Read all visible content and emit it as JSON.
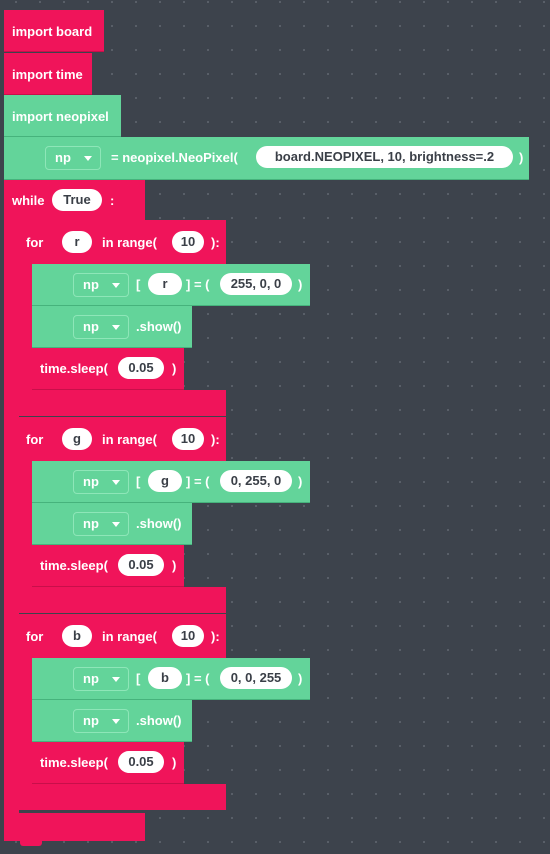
{
  "colors": {
    "background": "#3d434c",
    "control_block": "#f0145a",
    "value_block": "#63d49a"
  },
  "imports": [
    {
      "label": "import board"
    },
    {
      "label": "import time"
    },
    {
      "label": "import neopixel"
    }
  ],
  "assign": {
    "var": "np",
    "text": "= neopixel.NeoPixel(",
    "args": "board.NEOPIXEL, 10, brightness=.2",
    "close": ")"
  },
  "while_loop": {
    "keyword": "while",
    "condition": "True",
    "colon": ":"
  },
  "for_loops": [
    {
      "keyword": "for",
      "var": "r",
      "range_text": "in range(",
      "count": "10",
      "close": "):",
      "set_var": "np",
      "bracket_open": "[",
      "index": "r",
      "eq_text": "] = (",
      "color_value": "255, 0, 0",
      "close_paren": ")",
      "show_var": "np",
      "show_text": ".show()",
      "sleep_text": "time.sleep(",
      "sleep_value": "0.05",
      "sleep_close": ")"
    },
    {
      "keyword": "for",
      "var": "g",
      "range_text": "in range(",
      "count": "10",
      "close": "):",
      "set_var": "np",
      "bracket_open": "[",
      "index": "g",
      "eq_text": "] = (",
      "color_value": "0, 255, 0",
      "close_paren": ")",
      "show_var": "np",
      "show_text": ".show()",
      "sleep_text": "time.sleep(",
      "sleep_value": "0.05",
      "sleep_close": ")"
    },
    {
      "keyword": "for",
      "var": "b",
      "range_text": "in range(",
      "count": "10",
      "close": "):",
      "set_var": "np",
      "bracket_open": "[",
      "index": "b",
      "eq_text": "] = (",
      "color_value": "0, 0, 255",
      "close_paren": ")",
      "show_var": "np",
      "show_text": ".show()",
      "sleep_text": "time.sleep(",
      "sleep_value": "0.05",
      "sleep_close": ")"
    }
  ]
}
